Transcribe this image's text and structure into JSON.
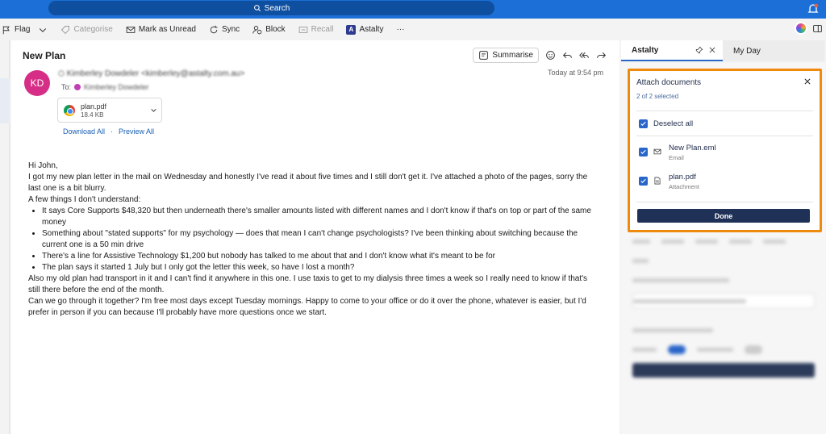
{
  "search": {
    "label": "Search"
  },
  "toolbar": {
    "flag": "Flag",
    "categorise": "Categorise",
    "mark_unread": "Mark as Unread",
    "sync": "Sync",
    "block": "Block",
    "recall": "Recall",
    "astalty": "Astalty",
    "more": "···"
  },
  "email": {
    "subject": "New Plan",
    "summarise": "Summarise",
    "avatar_initials": "KD",
    "sender": "Kimberley Dowdeler <kimberley@astalty.com.au>",
    "to_label": "To:",
    "to_recipient": "Kimberley Dowdeler",
    "timestamp": "Today at 9:54 pm",
    "attachment": {
      "name": "plan.pdf",
      "size": "18.4 KB"
    },
    "download_all": "Download All",
    "separator": "·",
    "preview_all": "Preview All",
    "greeting": "Hi John,",
    "para1": "I got my new plan letter in the mail on Wednesday and honestly I've read it about five times and I still don't get it. I've attached a photo of the pages, sorry the last one is a bit blurry.",
    "para2": "A few things I don't understand:",
    "bullets": [
      "It says Core Supports $48,320 but then underneath there's smaller amounts listed with different names and I don't know if that's on top or part of the same money",
      "Something about \"stated supports\" for my psychology — does that mean I can't change psychologists? I've been thinking about switching because the current one is a 50 min drive",
      "There's a line for Assistive Technology $1,200 but nobody has talked to me about that and I don't know what it's meant to be for",
      "The plan says it started 1 July but I only got the letter this week, so have I lost a month?"
    ],
    "para3": "Also my old plan had transport in it and I can't find it anywhere in this one. I use taxis to get to my dialysis three times a week so I really need to know if that's still there before the end of the month.",
    "para4": "Can we go through it together? I'm free most days except Tuesday mornings. Happy to come to your office or do it over the phone, whatever is easier, but I'd prefer in person if you can because I'll probably have more questions once we start."
  },
  "panel": {
    "tab_astalty": "Astalty",
    "tab_myday": "My Day"
  },
  "dialog": {
    "title": "Attach documents",
    "subtitle": "2 of 2 selected",
    "deselect_all": "Deselect all",
    "items": [
      {
        "name": "New Plan.eml",
        "type": "Email",
        "icon": "mail-icon",
        "checked": true
      },
      {
        "name": "plan.pdf",
        "type": "Attachment",
        "icon": "document-icon",
        "checked": true
      }
    ],
    "done": "Done"
  },
  "colors": {
    "brand_blue": "#1b6fd6",
    "highlight_orange": "#f08a0c",
    "avatar_pink": "#d62e86",
    "done_navy": "#1f3156"
  }
}
